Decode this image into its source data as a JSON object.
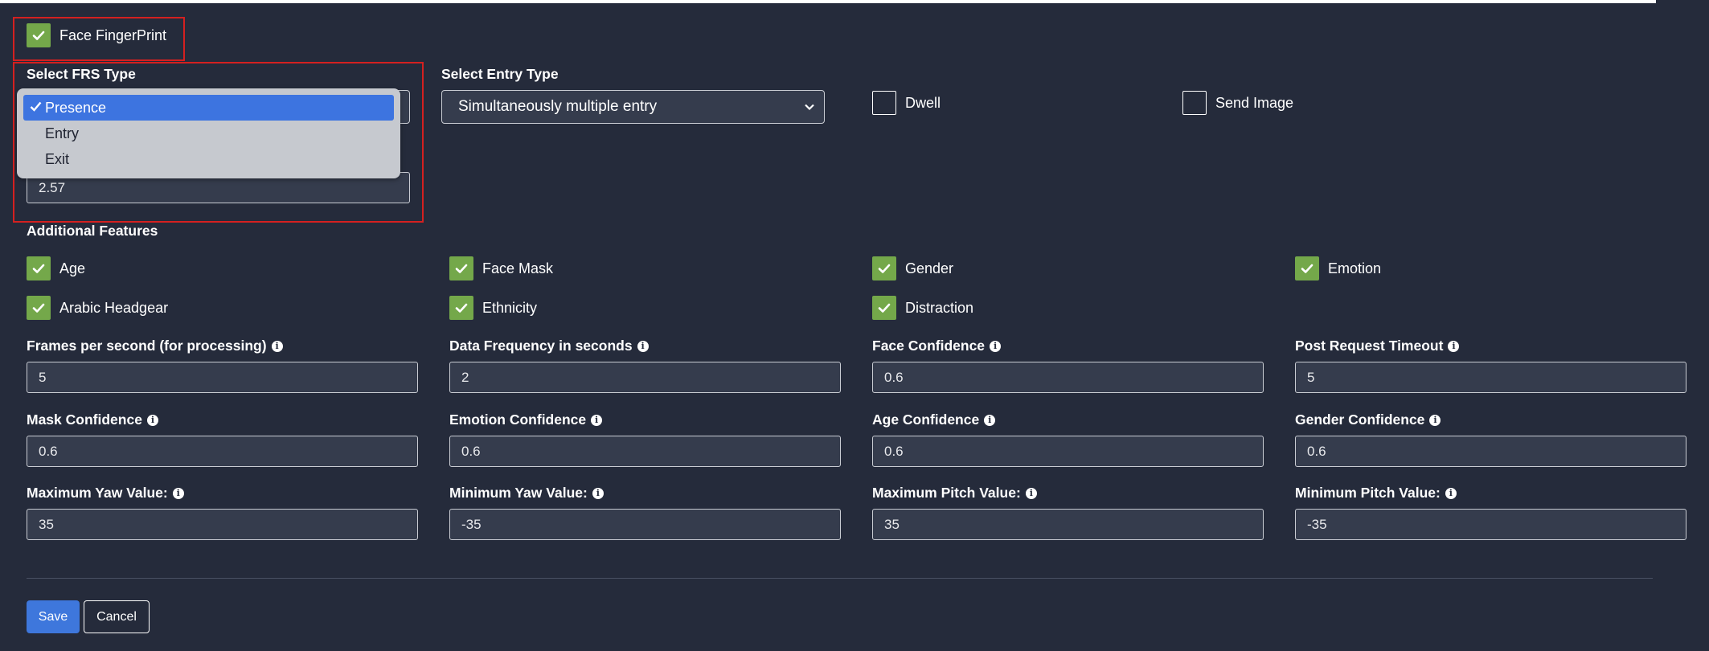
{
  "face_fingerprint": {
    "label": "Face FingerPrint",
    "checked": true
  },
  "frs_type": {
    "label": "Select FRS Type",
    "options": [
      "Presence",
      "Entry",
      "Exit"
    ],
    "selected": "Presence",
    "value_below": "2.57"
  },
  "entry_type": {
    "label": "Select Entry Type",
    "value": "Simultaneously multiple entry"
  },
  "dwell": {
    "label": "Dwell",
    "checked": false
  },
  "send_image": {
    "label": "Send Image",
    "checked": false
  },
  "additional_features": {
    "title": "Additional Features",
    "items": [
      {
        "label": "Age",
        "checked": true
      },
      {
        "label": "Face Mask",
        "checked": true
      },
      {
        "label": "Gender",
        "checked": true
      },
      {
        "label": "Emotion",
        "checked": true
      },
      {
        "label": "Arabic Headgear",
        "checked": true
      },
      {
        "label": "Ethnicity",
        "checked": true
      },
      {
        "label": "Distraction",
        "checked": true
      }
    ]
  },
  "fields": [
    {
      "label": "Frames per second (for processing)",
      "value": "5"
    },
    {
      "label": "Data Frequency in seconds",
      "value": "2"
    },
    {
      "label": "Face Confidence",
      "value": "0.6"
    },
    {
      "label": "Post Request Timeout",
      "value": "5"
    },
    {
      "label": "Mask Confidence",
      "value": "0.6"
    },
    {
      "label": "Emotion Confidence",
      "value": "0.6"
    },
    {
      "label": "Age Confidence",
      "value": "0.6"
    },
    {
      "label": "Gender Confidence",
      "value": "0.6"
    },
    {
      "label": "Maximum Yaw Value:",
      "value": "35"
    },
    {
      "label": "Minimum Yaw Value:",
      "value": "-35"
    },
    {
      "label": "Maximum Pitch Value:",
      "value": "35"
    },
    {
      "label": "Minimum Pitch Value:",
      "value": "-35"
    }
  ],
  "buttons": {
    "save": "Save",
    "cancel": "Cancel"
  },
  "icons": {
    "checkbox_check": "check-icon",
    "info": "info-icon",
    "select_arrow": "chevron-down-icon"
  },
  "colors": {
    "background": "#252b3b",
    "checked": "#74a84a",
    "primary": "#3e77dc",
    "highlight_box": "#d42020"
  }
}
